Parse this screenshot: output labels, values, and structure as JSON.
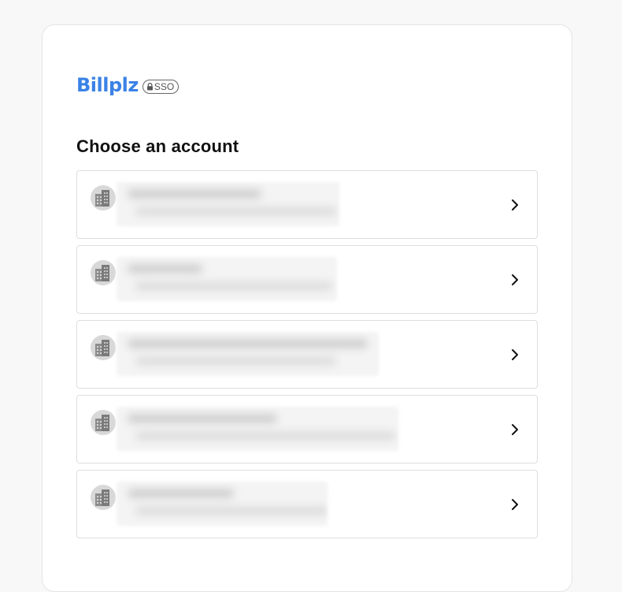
{
  "brand": {
    "name": "Billplz",
    "badge": "SSO",
    "color": "#3b82e6"
  },
  "page": {
    "heading": "Choose an account"
  },
  "accounts": [
    {
      "name": "",
      "subtitle": "",
      "icon": "building-icon"
    },
    {
      "name": "",
      "subtitle": "",
      "icon": "building-icon"
    },
    {
      "name": "",
      "subtitle": "",
      "icon": "building-icon"
    },
    {
      "name": "",
      "subtitle": "",
      "icon": "building-icon"
    },
    {
      "name": "",
      "subtitle": "",
      "icon": "building-icon"
    }
  ]
}
